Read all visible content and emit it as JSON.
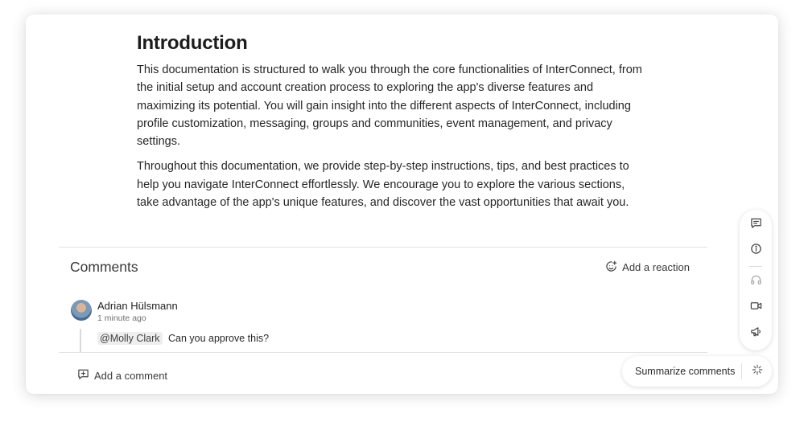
{
  "document": {
    "title": "Introduction",
    "paragraphs": [
      "This documentation is structured to walk you through the core functionalities of InterConnect, from the initial setup and account creation process to exploring the app's diverse features and maximizing its potential. You will gain insight into the different aspects of InterConnect, including profile customization, messaging, groups and communities, event management, and privacy settings.",
      "Throughout this documentation, we provide step-by-step instructions, tips, and best practices to help you navigate InterConnect effortlessly. We encourage you to explore the various sections, take advantage of the app's unique features, and discover the vast opportunities that await you."
    ]
  },
  "comments": {
    "title": "Comments",
    "add_reaction_label": "Add a reaction",
    "items": [
      {
        "author": "Adrian Hülsmann",
        "time": "1 minute ago",
        "mention": "@Molly Clark",
        "text": "Can you approve this?"
      }
    ],
    "add_comment_label": "Add a comment"
  },
  "rail_icons": [
    "comment-icon",
    "info-icon",
    "headset-icon",
    "video-icon",
    "megaphone-icon"
  ],
  "summarize": {
    "label": "Summarize comments",
    "icon": "sparkle-icon"
  }
}
